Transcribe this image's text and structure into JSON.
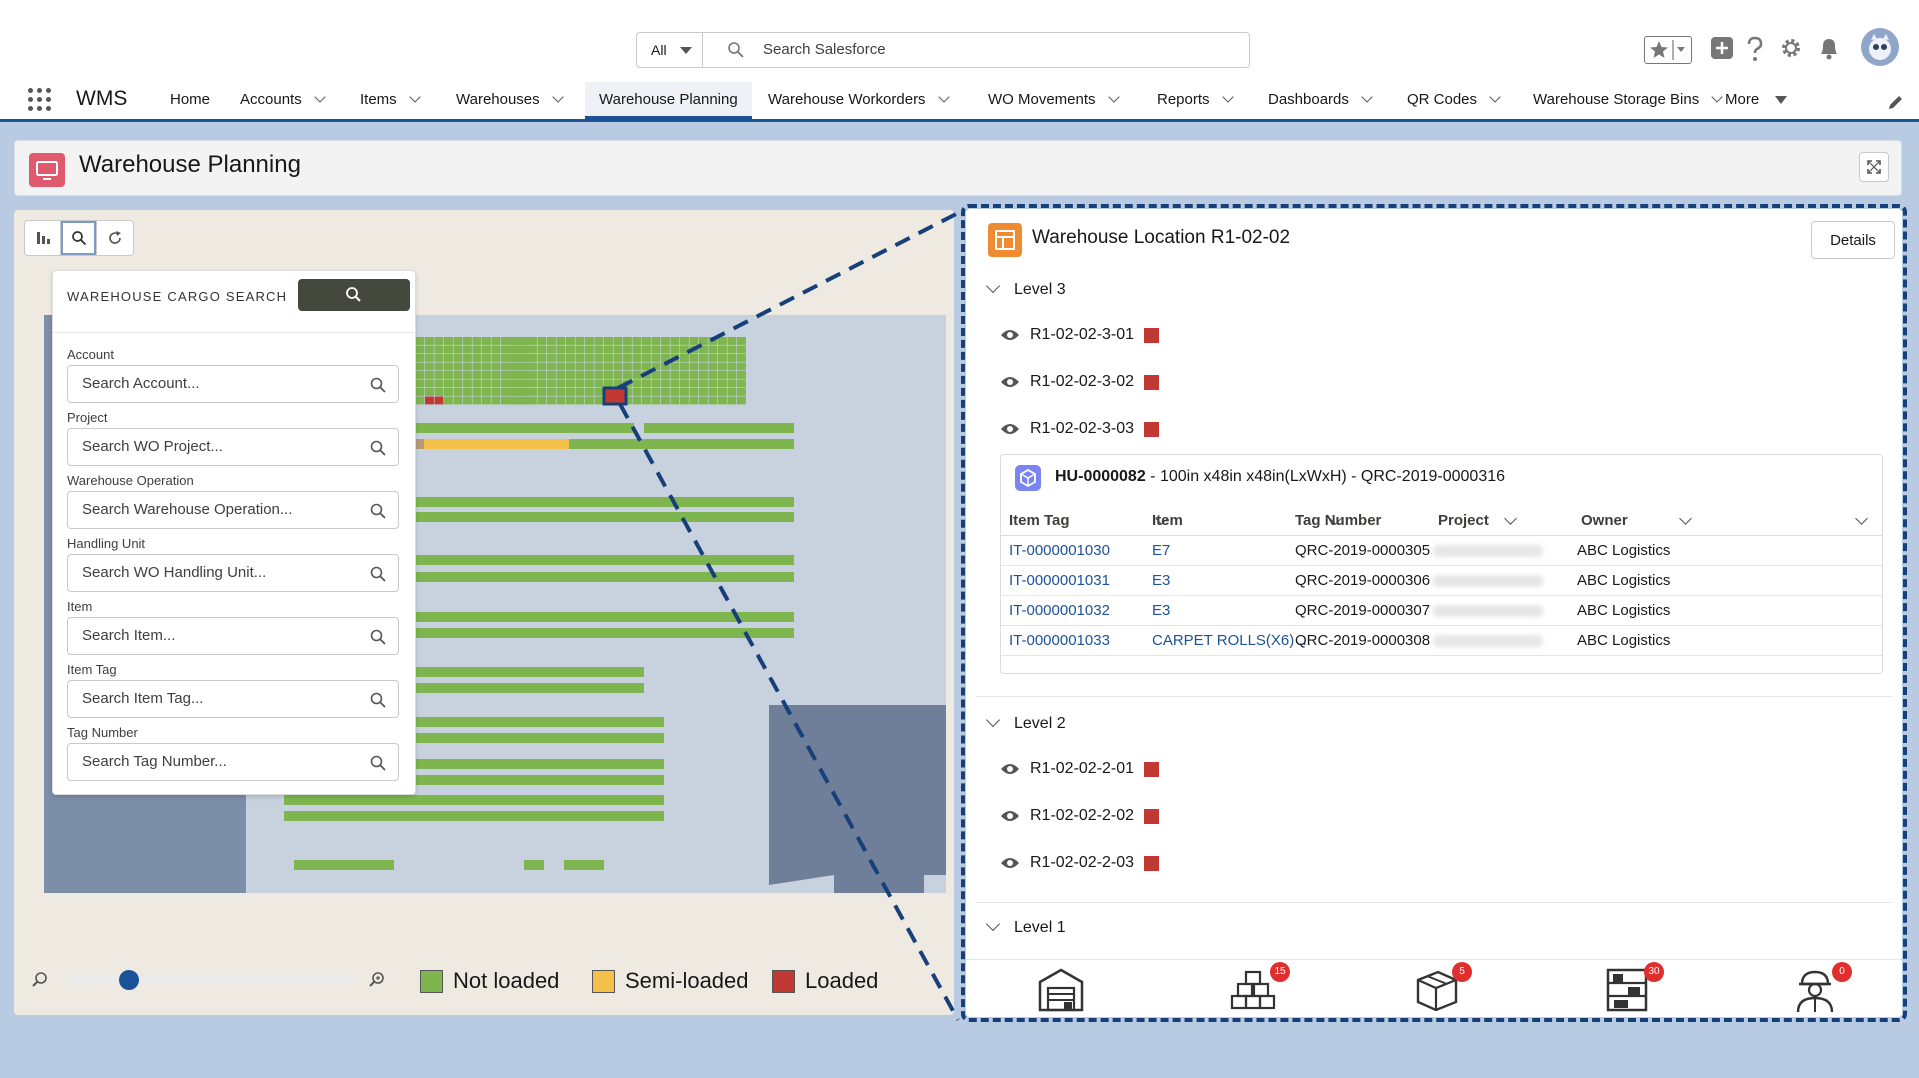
{
  "header": {
    "search_scope": "All",
    "search_placeholder": "Search Salesforce"
  },
  "nav": {
    "app_name": "WMS",
    "items": [
      {
        "label": "Home"
      },
      {
        "label": "Accounts"
      },
      {
        "label": "Items"
      },
      {
        "label": "Warehouses"
      },
      {
        "label": "Warehouse Planning"
      },
      {
        "label": "Warehouse Workorders"
      },
      {
        "label": "WO Movements"
      },
      {
        "label": "Reports"
      },
      {
        "label": "Dashboards"
      },
      {
        "label": "QR Codes"
      },
      {
        "label": "Warehouse Storage Bins"
      },
      {
        "label": "More"
      }
    ]
  },
  "page": {
    "title": "Warehouse Planning"
  },
  "cargo_search": {
    "title": "WAREHOUSE CARGO SEARCH",
    "fields": [
      {
        "label": "Account",
        "placeholder": "Search Account..."
      },
      {
        "label": "Project",
        "placeholder": "Search WO Project..."
      },
      {
        "label": "Warehouse Operation",
        "placeholder": "Search Warehouse Operation..."
      },
      {
        "label": "Handling Unit",
        "placeholder": "Search WO Handling Unit..."
      },
      {
        "label": "Item",
        "placeholder": "Search Item..."
      },
      {
        "label": "Item Tag",
        "placeholder": "Search Item Tag..."
      },
      {
        "label": "Tag Number",
        "placeholder": "Search Tag Number..."
      }
    ]
  },
  "legend": {
    "not_loaded": "Not loaded",
    "semi_loaded": "Semi-loaded",
    "loaded": "Loaded",
    "colors": {
      "not_loaded": "#7fb54e",
      "semi_loaded": "#f3c04a",
      "loaded": "#c23934"
    }
  },
  "zoom": {
    "level_fraction": 0.2
  },
  "location": {
    "title": "Warehouse Location R1-02-02",
    "details_label": "Details",
    "level3": {
      "label": "Level 3",
      "locations": [
        "R1-02-02-3-01",
        "R1-02-02-3-02",
        "R1-02-02-3-03"
      ]
    },
    "handling_unit": {
      "id": "HU-0000082",
      "desc": " - 100in x48in x48in(LxWxH) - QRC-2019-0000316",
      "columns": [
        "Item Tag",
        "Item",
        "Tag Number",
        "Project",
        "Owner"
      ],
      "rows": [
        {
          "tag": "IT-0000001030",
          "item": "E7",
          "tag_number": "QRC-2019-0000305",
          "owner": "ABC Logistics"
        },
        {
          "tag": "IT-0000001031",
          "item": "E3",
          "tag_number": "QRC-2019-0000306",
          "owner": "ABC Logistics"
        },
        {
          "tag": "IT-0000001032",
          "item": "E3",
          "tag_number": "QRC-2019-0000307",
          "owner": "ABC Logistics"
        },
        {
          "tag": "IT-0000001033",
          "item": "CARPET ROLLS(X6) ...",
          "tag_number": "QRC-2019-0000308",
          "owner": "ABC Logistics"
        }
      ]
    },
    "level2": {
      "label": "Level 2",
      "locations": [
        "R1-02-02-2-01",
        "R1-02-02-2-02",
        "R1-02-02-2-03"
      ]
    },
    "level1": {
      "label": "Level 1"
    }
  },
  "bottom_icons": [
    {
      "icon": "warehouse-icon",
      "badge": ""
    },
    {
      "icon": "boxes-icon",
      "badge": "15"
    },
    {
      "icon": "package-icon",
      "badge": "5"
    },
    {
      "icon": "storage-rack-icon",
      "badge": "30"
    },
    {
      "icon": "worker-icon",
      "badge": "0"
    }
  ]
}
